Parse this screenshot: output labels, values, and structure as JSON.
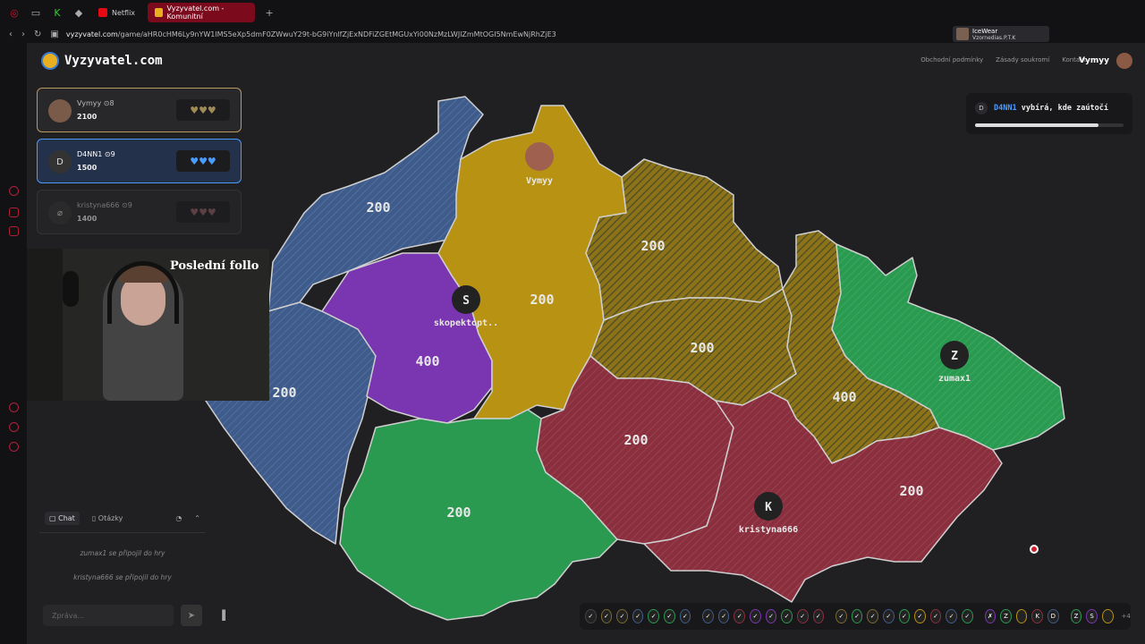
{
  "browser": {
    "tabs": [
      {
        "label": "Netflix",
        "color": "#e50914"
      },
      {
        "label": "Vyzyvatel.com - Komunitní",
        "color": "#e8b020"
      }
    ],
    "new_tab_label": "+",
    "url_domain": "vyzyvatel.com",
    "url_path": "/game/aHR0cHM6Ly9nYW1lMS5eXp5dmF0ZWwuY29t-bG9iYnlfZjExNDFiZGEtMGUxYi00NzMzLWJlZmMtOGI5NmEwNjRhZjE3",
    "profile_name": "IceWear",
    "profile_sub": "Vzornedias.P.T.K"
  },
  "site": {
    "logo_text": "Vyzyvatel.com",
    "links": [
      "Obchodní podmínky",
      "Zásady soukromí",
      "Kontakt"
    ],
    "user": "Vymyy"
  },
  "players": [
    {
      "name": "Vymyy",
      "level": "8",
      "score": "2100",
      "avatar": "",
      "hearts": "♥♥♥",
      "heart_color": "#a08a55"
    },
    {
      "name": "D4NN1",
      "level": "9",
      "score": "1500",
      "avatar": "D",
      "hearts": "♥♥♥",
      "heart_color": "#4a9cff"
    },
    {
      "name": "kristyna666",
      "level": "9",
      "score": "1400",
      "avatar": "",
      "hearts": "♥♥♥",
      "heart_color": "#8a5a60"
    }
  ],
  "stream_overlay": "Poslední follo",
  "chat": {
    "tab_chat": "Chat",
    "tab_questions": "Otázky",
    "messages": [
      "zumax1 se připojil do hry",
      "kristyna666 se připojil do hry"
    ],
    "placeholder": "Zpráva..."
  },
  "turn": {
    "avatar": "D",
    "player": "D4NN1",
    "text": " vybírá, kde zaútočí",
    "progress": 0.83
  },
  "map": {
    "regions": [
      {
        "value": "200",
        "owner": "blue"
      },
      {
        "value": "200",
        "owner": "blue"
      },
      {
        "value": "400",
        "owner": "purple"
      },
      {
        "value": "200",
        "owner": "yellow"
      },
      {
        "value": "200",
        "owner": "yellow-hatched"
      },
      {
        "value": "200",
        "owner": "yellow-hatched"
      },
      {
        "value": "400",
        "owner": "yellow-hatched"
      },
      {
        "value": "200",
        "owner": "green"
      },
      {
        "value": "200",
        "owner": "red"
      },
      {
        "value": "200",
        "owner": "red"
      }
    ],
    "bases": [
      {
        "label": "Vymyy",
        "initial": ""
      },
      {
        "label": "skopektopt..",
        "initial": "S"
      },
      {
        "label": "zumax1",
        "initial": "Z"
      },
      {
        "label": "kristyna666",
        "initial": "K"
      }
    ],
    "colors": {
      "blue": "#3f5b8a",
      "yellow": "#b89212",
      "purple": "#7a36b0",
      "green": "#2a9a50",
      "red": "#8a2f3e"
    }
  },
  "history": {
    "chips": [
      "✓",
      "✓",
      "✓",
      "✓",
      "✓",
      "✓",
      "✓",
      "✓",
      "✓",
      "✓",
      "✓",
      "✓",
      "✓",
      "✓",
      "✓",
      "✓",
      "✓",
      "✓",
      "✓",
      "✓",
      "✓",
      "✓",
      "✓",
      "✓",
      "✗",
      "Z",
      "",
      "K",
      "D",
      "Z",
      "S",
      ""
    ],
    "more": "+4"
  }
}
